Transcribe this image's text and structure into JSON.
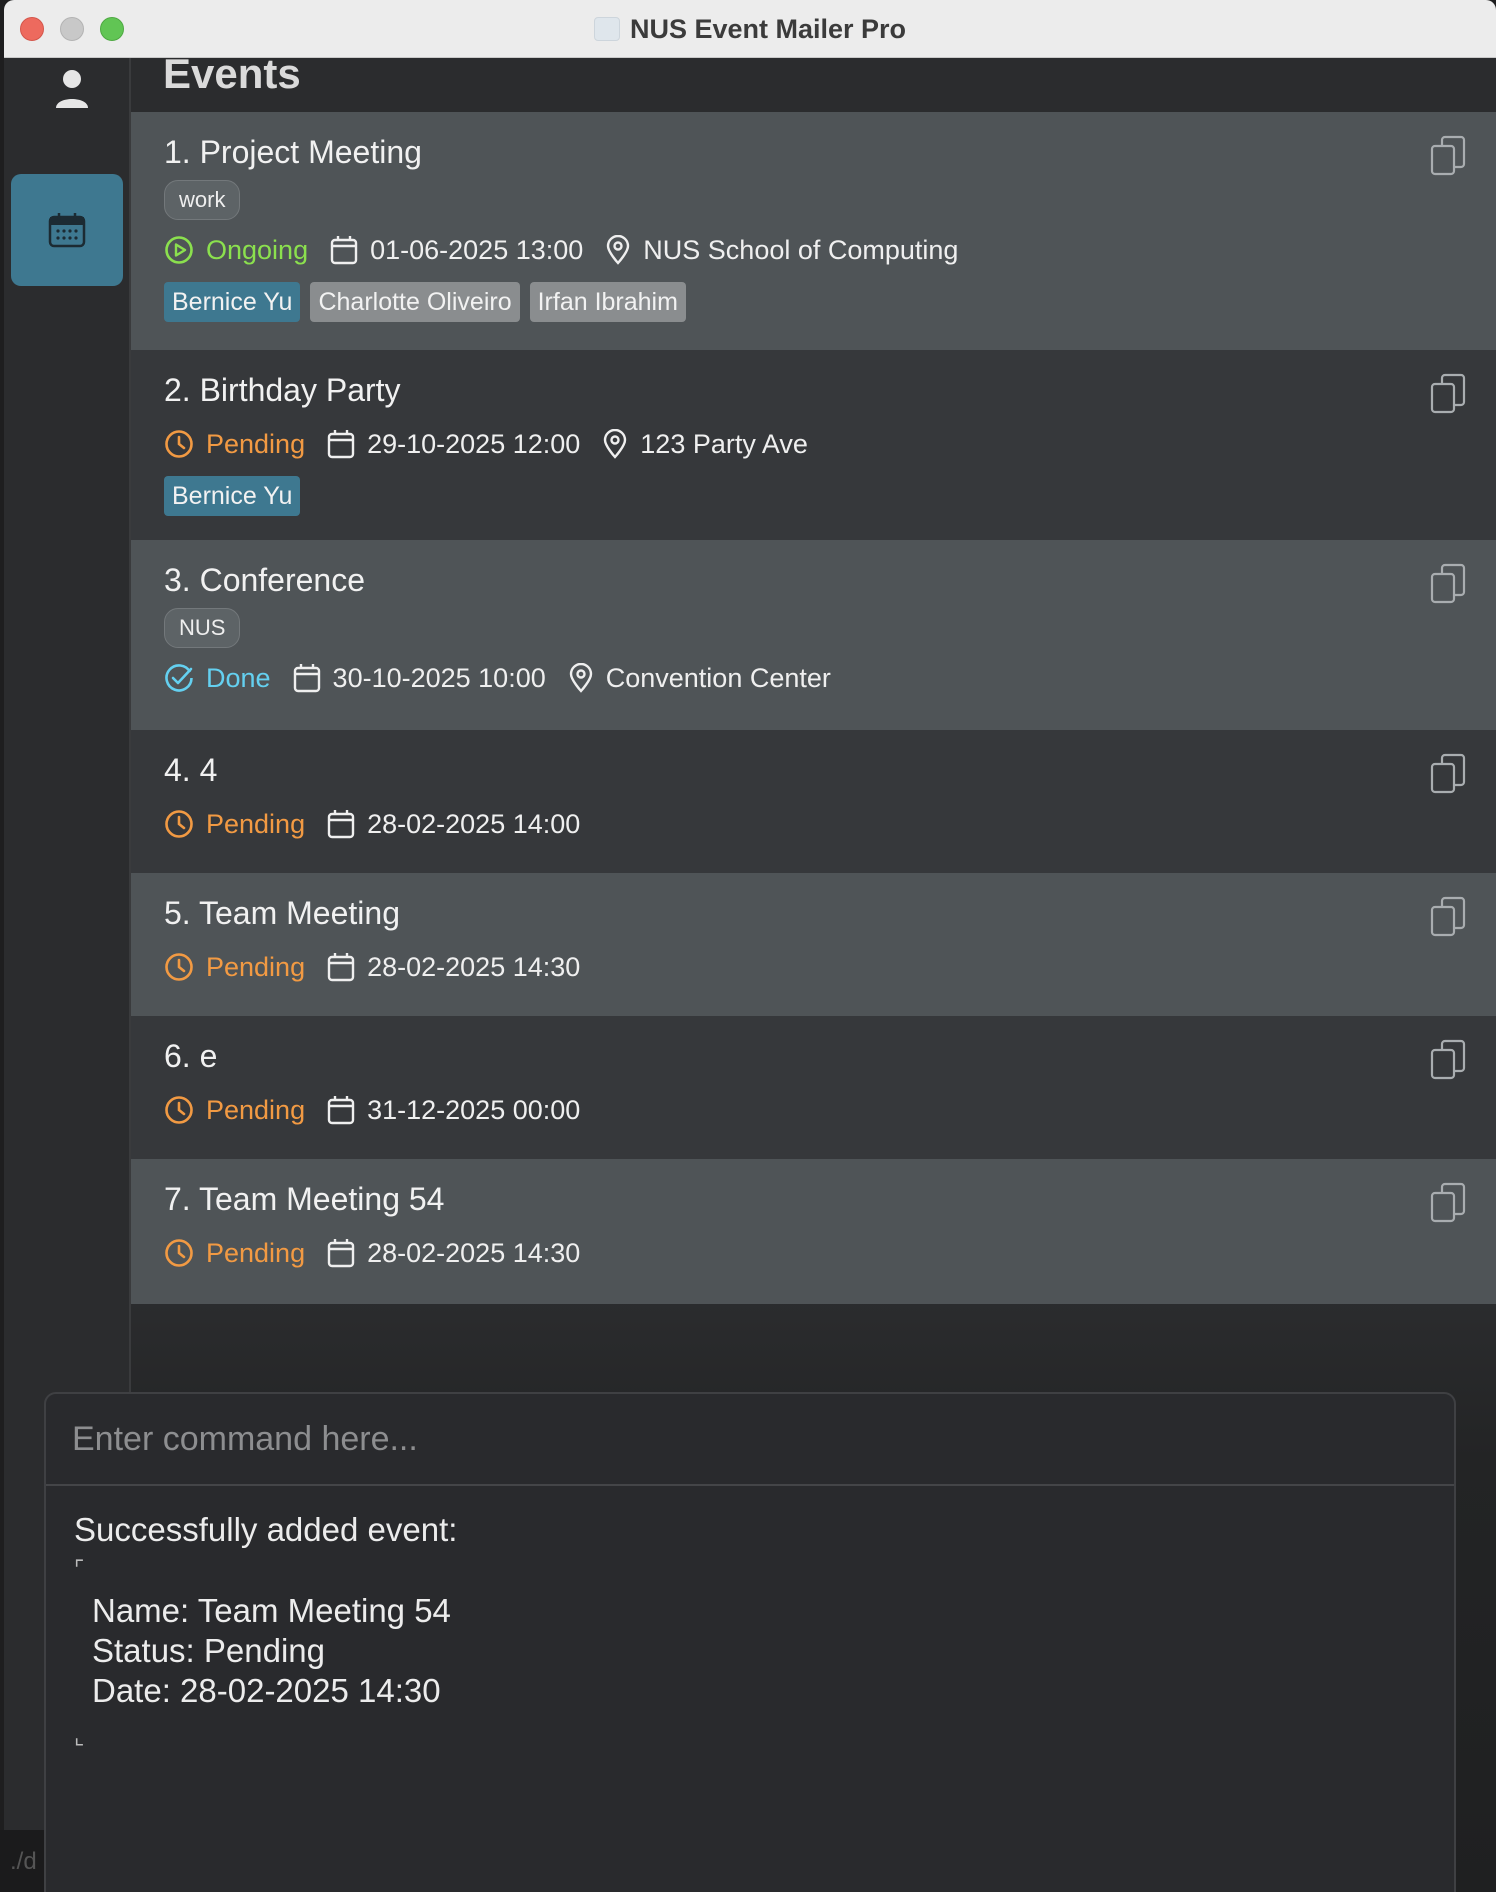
{
  "window": {
    "title": "NUS Event Mailer Pro"
  },
  "sidebar": {
    "items": [
      {
        "icon": "person-icon"
      },
      {
        "icon": "calendar-icon",
        "active": true
      }
    ]
  },
  "main": {
    "heading": "Events"
  },
  "events": [
    {
      "title": "1. Project Meeting",
      "tag": "work",
      "status": "Ongoing",
      "date": "01-06-2025 13:00",
      "location": "NUS School of Computing",
      "people": [
        "Bernice Yu",
        "Charlotte Oliveiro",
        "Irfan Ibrahim"
      ]
    },
    {
      "title": "2. Birthday Party",
      "status": "Pending",
      "date": "29-10-2025 12:00",
      "location": "123 Party Ave",
      "people": [
        "Bernice Yu"
      ]
    },
    {
      "title": "3. Conference",
      "tag": "NUS",
      "status": "Done",
      "date": "30-10-2025 10:00",
      "location": "Convention Center"
    },
    {
      "title": "4. 4",
      "status": "Pending",
      "date": "28-02-2025 14:00"
    },
    {
      "title": "5. Team Meeting",
      "status": "Pending",
      "date": "28-02-2025 14:30"
    },
    {
      "title": "6. e",
      "status": "Pending",
      "date": "31-12-2025 00:00"
    },
    {
      "title": "7. Team Meeting 54",
      "status": "Pending",
      "date": "28-02-2025 14:30"
    }
  ],
  "command": {
    "placeholder": "Enter command here...",
    "result_header": "Successfully added event:",
    "result_lines": [
      "Name: Team Meeting 54",
      "Status: Pending",
      "Date: 28-02-2025 14:30"
    ],
    "bracket_open": "⌜",
    "bracket_close": "⌞"
  },
  "status_bar": {
    "text": "./d"
  },
  "colors": {
    "ongoing": "#8be04e",
    "pending": "#f29a43",
    "done": "#64d0f0",
    "accent": "#3e7890"
  }
}
